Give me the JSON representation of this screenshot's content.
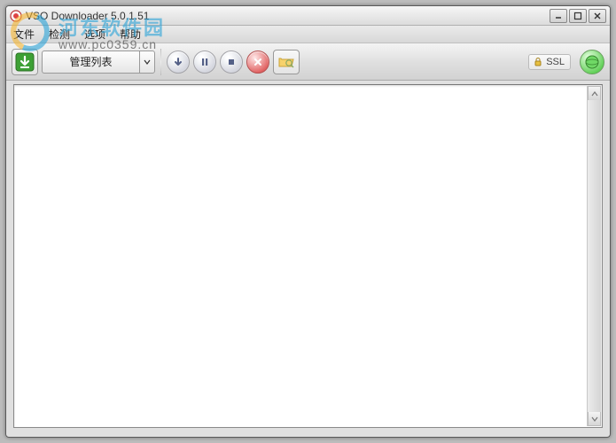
{
  "window": {
    "title": "VSO Downloader 5.0.1.51"
  },
  "menubar": {
    "file": "文件",
    "detect": "检测",
    "options": "选项",
    "help": "帮助"
  },
  "toolbar": {
    "download_icon": "download-icon",
    "manage_label": "管理列表",
    "start_icon": "start-icon",
    "pause_icon": "pause-icon",
    "stop_icon": "stop-icon",
    "delete_icon": "delete-icon",
    "folder_icon": "folder-search-icon",
    "ssl_label": "SSL",
    "globe_icon": "globe-icon"
  },
  "watermark": {
    "brand": "河东软件园",
    "url": "www.pc0359.cn"
  }
}
